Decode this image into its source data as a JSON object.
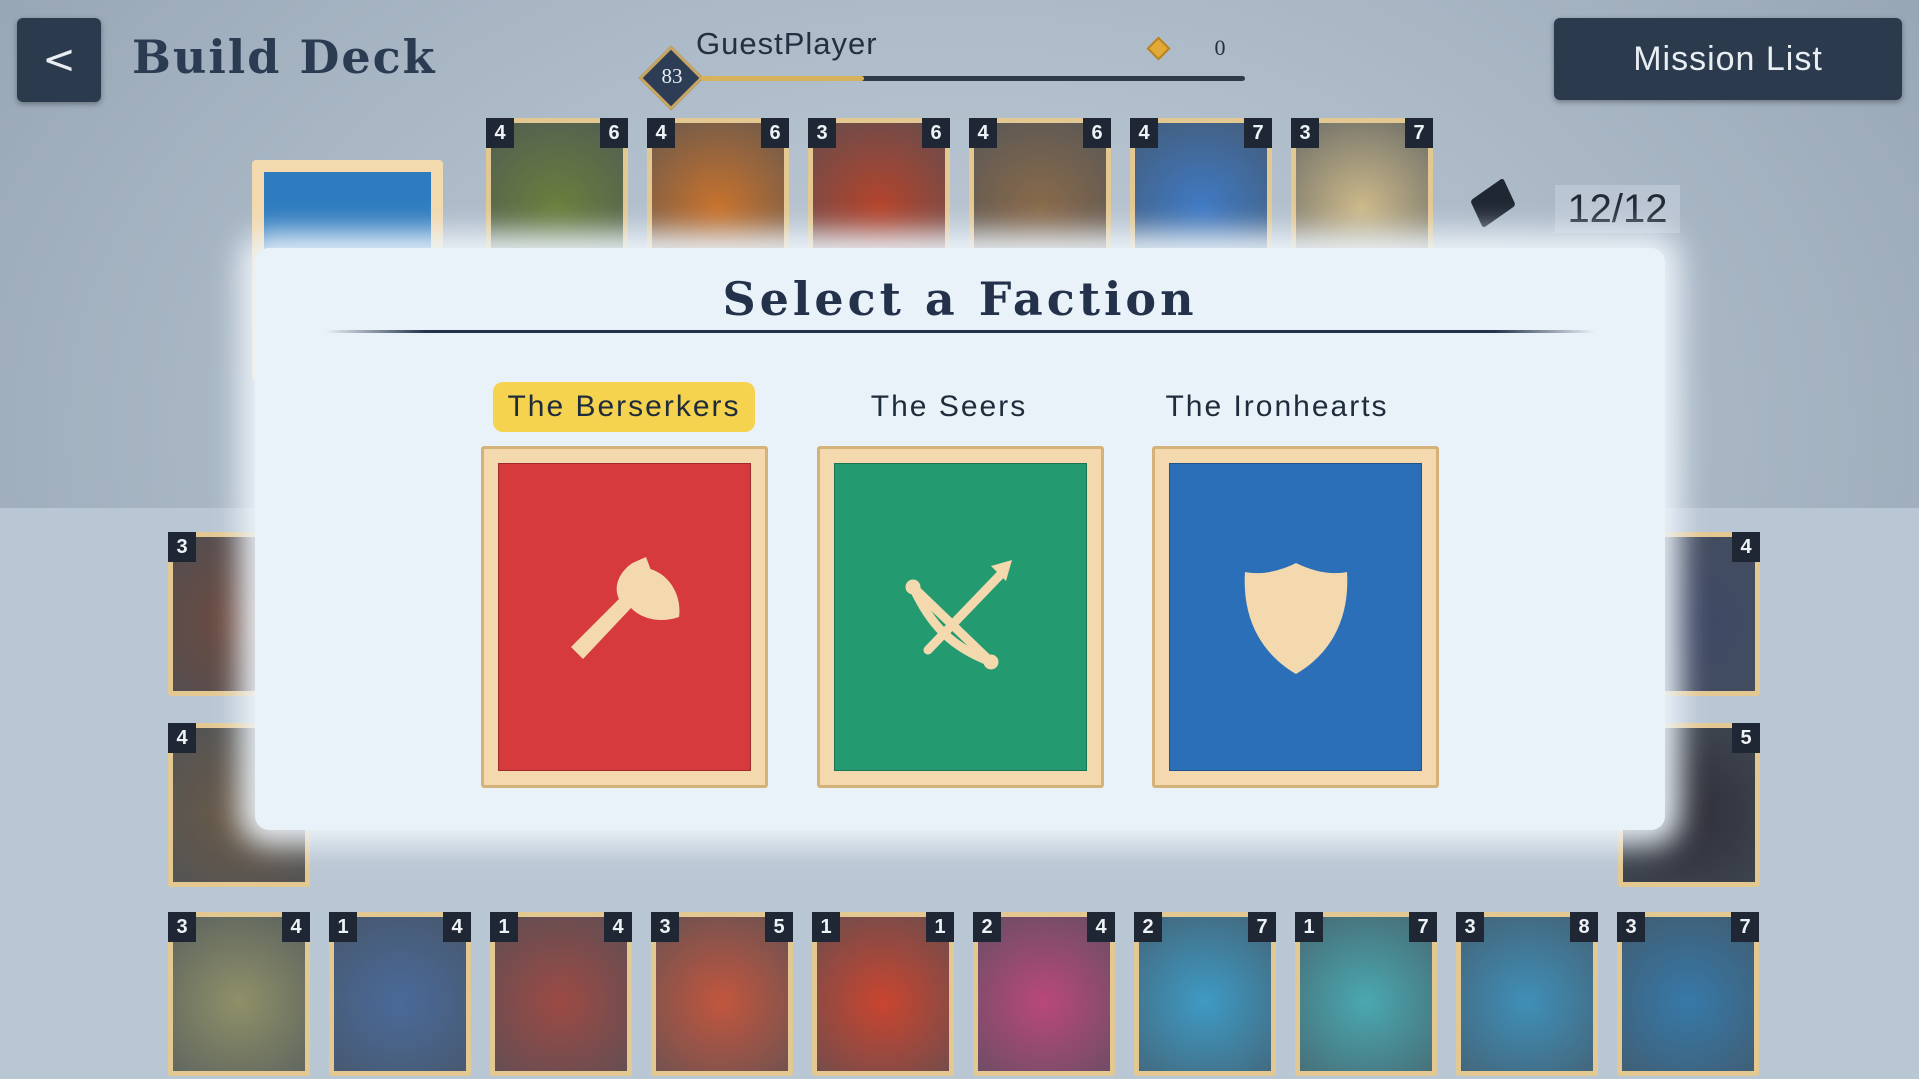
{
  "header": {
    "back_label": "<",
    "title": "Build Deck",
    "player": {
      "name": "GuestPlayer",
      "level": "83",
      "xp_progress": 0.3,
      "gems": "0"
    },
    "mission_button": "Mission List"
  },
  "deck": {
    "count": "12/12"
  },
  "deck_cards": [
    {
      "cost": "4",
      "power": "6",
      "icon": "goblin-archer",
      "art": "#6a7f3d"
    },
    {
      "cost": "4",
      "power": "6",
      "icon": "dwarf-warrior",
      "art": "#c8722c"
    },
    {
      "cost": "3",
      "power": "6",
      "icon": "red-beast",
      "art": "#b5442c"
    },
    {
      "cost": "4",
      "power": "6",
      "icon": "bearded-warrior",
      "art": "#8a6a4a"
    },
    {
      "cost": "4",
      "power": "7",
      "icon": "crystal-golem",
      "art": "#3f7ac4"
    },
    {
      "cost": "3",
      "power": "7",
      "icon": "skeleton",
      "art": "#cdb98a"
    }
  ],
  "collection": {
    "row1_left": {
      "cost": "3",
      "icon": "red-beast",
      "art": "#6e4a3e"
    },
    "row1_right": {
      "power": "4",
      "icon": "shadow-beast",
      "art": "#3e4866"
    },
    "row2_left": {
      "cost": "4",
      "icon": "bearded-warrior",
      "art": "#6b5a48"
    },
    "row2_right": {
      "power": "5",
      "icon": "demon-skull",
      "art": "#2f2f3a"
    },
    "row3": [
      {
        "cost": "3",
        "power": "4",
        "icon": "rock-golem",
        "art": "#8f9068"
      },
      {
        "cost": "1",
        "power": "4",
        "icon": "blue-mage",
        "art": "#4a6a9a"
      },
      {
        "cost": "1",
        "power": "4",
        "icon": "flesh-horror",
        "art": "#9c4a44"
      },
      {
        "cost": "3",
        "power": "5",
        "icon": "skull-beast",
        "art": "#c2563e"
      },
      {
        "cost": "1",
        "power": "1",
        "icon": "red-chomper",
        "art": "#c9452f"
      },
      {
        "cost": "2",
        "power": "4",
        "icon": "eye-monster",
        "art": "#b9487a"
      },
      {
        "cost": "2",
        "power": "7",
        "icon": "blue-frog",
        "art": "#3e9ac4"
      },
      {
        "cost": "1",
        "power": "7",
        "icon": "sea-warrior",
        "art": "#4aa8b0"
      },
      {
        "cost": "3",
        "power": "8",
        "icon": "sea-dragon",
        "art": "#3f8fb8"
      },
      {
        "cost": "3",
        "power": "7",
        "icon": "anglerfish",
        "art": "#3679a8"
      }
    ]
  },
  "modal": {
    "title": "Select a Faction",
    "factions": [
      {
        "name": "The Berserkers",
        "icon": "axe-icon",
        "color": "#d63a3c",
        "selected": true
      },
      {
        "name": "The Seers",
        "icon": "crossbow-icon",
        "color": "#239a70",
        "selected": false
      },
      {
        "name": "The Ironhearts",
        "icon": "shield-icon",
        "color": "#2a6fb8",
        "selected": false
      }
    ]
  }
}
